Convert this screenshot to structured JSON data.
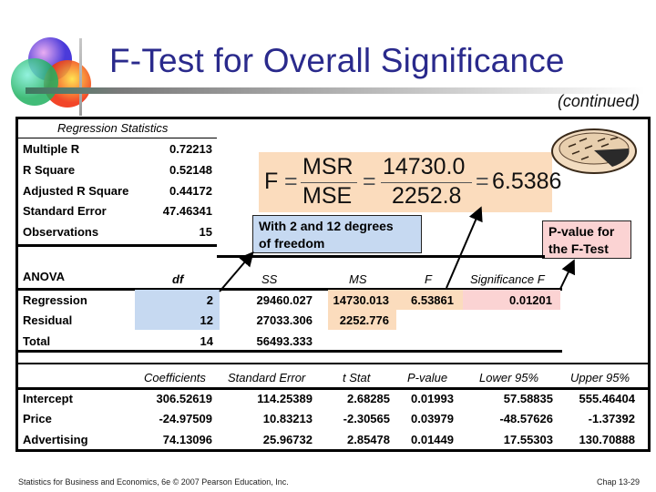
{
  "slide": {
    "title": "F-Test for Overall Significance",
    "subtitle": "(continued)",
    "footer_left": "Statistics for Business and Economics, 6e © 2007 Pearson Education, Inc.",
    "footer_right": "Chap 13-29"
  },
  "colors": {
    "title": "#2a2a8c",
    "blue_highlight": "#c6d9f1",
    "orange_highlight": "#fbdcbd",
    "pink_highlight": "#fbd3d3"
  },
  "regression_statistics": {
    "header": "Regression Statistics",
    "rows": [
      {
        "label": "Multiple R",
        "value": "0.72213"
      },
      {
        "label": "R Square",
        "value": "0.52148"
      },
      {
        "label": "Adjusted R Square",
        "value": "0.44172"
      },
      {
        "label": "Standard Error",
        "value": "47.46341"
      },
      {
        "label": "Observations",
        "value": "15"
      }
    ]
  },
  "formula": {
    "lhs": "F",
    "eq": "=",
    "num1": "MSR",
    "den1": "MSE",
    "num2": "14730.0",
    "den2": "2252.8",
    "result": "6.5386"
  },
  "callouts": {
    "df_line1": "With 2 and 12 degrees",
    "df_line2": "of freedom",
    "pv_line1": "P-value for",
    "pv_line2": "the F-Test"
  },
  "anova": {
    "title": "ANOVA",
    "headers": [
      "df",
      "SS",
      "MS",
      "F",
      "Significance F"
    ],
    "rows": [
      {
        "label": "Regression",
        "df": "2",
        "ss": "29460.027",
        "ms": "14730.013",
        "f": "6.53861",
        "sig": "0.01201"
      },
      {
        "label": "Residual",
        "df": "12",
        "ss": "27033.306",
        "ms": "2252.776",
        "f": "",
        "sig": ""
      },
      {
        "label": "Total",
        "df": "14",
        "ss": "56493.333",
        "ms": "",
        "f": "",
        "sig": ""
      }
    ]
  },
  "coefficients": {
    "headers": [
      "Coefficients",
      "Standard Error",
      "t Stat",
      "P-value",
      "Lower 95%",
      "Upper 95%"
    ],
    "rows": [
      {
        "label": "Intercept",
        "coef": "306.52619",
        "se": "114.25389",
        "t": "2.68285",
        "p": "0.01993",
        "lo": "57.58835",
        "hi": "555.46404"
      },
      {
        "label": "Price",
        "coef": "-24.97509",
        "se": "10.83213",
        "t": "-2.30565",
        "p": "0.03979",
        "lo": "-48.57626",
        "hi": "-1.37392"
      },
      {
        "label": "Advertising",
        "coef": "74.13096",
        "se": "25.96732",
        "t": "2.85478",
        "p": "0.01449",
        "lo": "17.55303",
        "hi": "130.70888"
      }
    ]
  }
}
